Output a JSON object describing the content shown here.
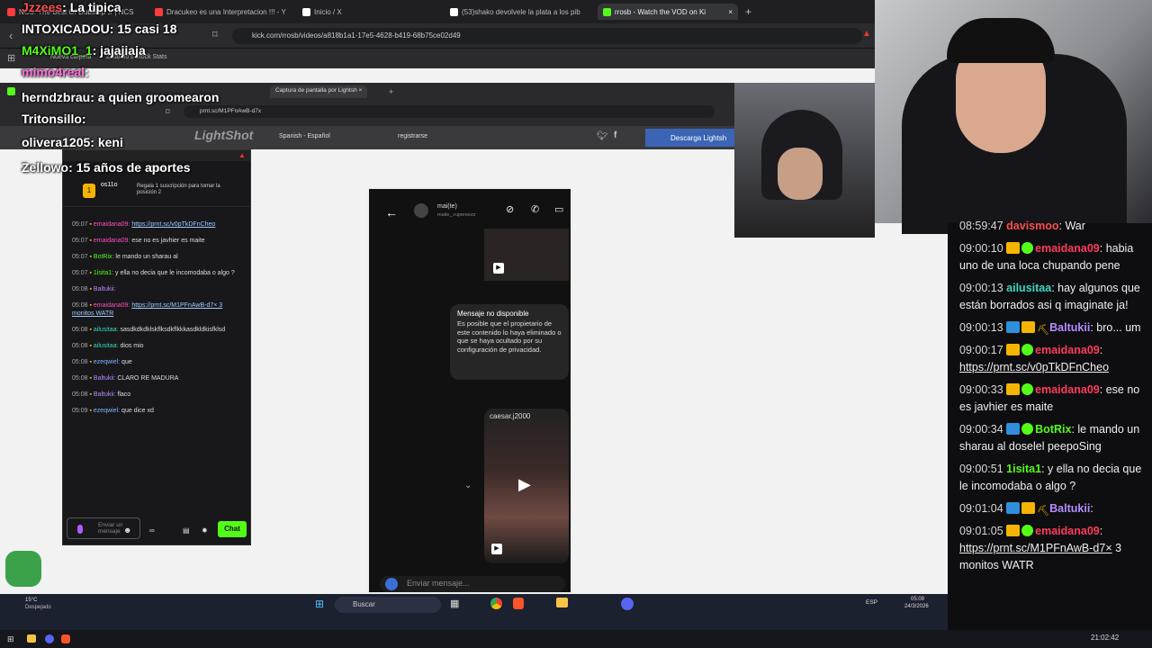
{
  "browser": {
    "tabs": [
      {
        "label": "NCS: The Best Of Dubstep ♫ | NCS",
        "color": "#ff3b3b"
      },
      {
        "label": "Dracukeo es una Interpretacion !!! - Y",
        "color": "#ff3b3b"
      },
      {
        "label": "Inicio / X",
        "color": "#ffffff"
      },
      {
        "label": "(53)shako devolvele la plata a los pib",
        "color": "#ffffff"
      },
      {
        "label": "rrosb - Watch the VOD on Ki",
        "color": "#53fc18"
      }
    ],
    "new_tab": "+",
    "url": "kick.com/rrosb/videos/a818b1a1-17e5-4628-b419-68b75ce02d49",
    "bookmarks": [
      "Nueva carpeta",
      "Zalando's Stock Stats"
    ]
  },
  "inner_browser": {
    "tabs": [
      "Captura de pantalla por Lightsh"
    ],
    "url": "prnt.sc/M1PFnAwB-d7x",
    "lang": "Spanish - Español",
    "register": "registrarse",
    "download": "Descarga Lightsh",
    "logo": "LightShot"
  },
  "kick_panel": {
    "title": "Chat",
    "sub_user": "os11o",
    "sub_note": "Regala 1 suscripción para tomar la posición 2",
    "rank": "1",
    "messages": [
      {
        "t": "05:07",
        "u": "emaidana09:",
        "c": "u-pink",
        "m": "https://prnt.sc/v0pTkDFnCheo",
        "link": true
      },
      {
        "t": "05:07",
        "u": "emaidana09:",
        "c": "u-pink",
        "m": "ese no es javhier es maite"
      },
      {
        "t": "05:07",
        "u": "BotRix:",
        "c": "u-green",
        "m": "le mando un sharau al"
      },
      {
        "t": "05:07",
        "u": "1isita1:",
        "c": "u-green",
        "m": "y ella no decia que le incomodaba o algo ?"
      },
      {
        "t": "05:08",
        "u": "Baltukii:",
        "c": "u-purple",
        "m": ""
      },
      {
        "t": "05:08",
        "u": "emaidana09:",
        "c": "u-pink",
        "m": "https://prnt.sc/M1PFnAwB-d7× 3 monitos WATR",
        "link": true
      },
      {
        "t": "05:08",
        "u": "ailusitaa:",
        "c": "u-teal",
        "m": "sasdkdkdklskflksdkflkkkasdkldkisfklsd"
      },
      {
        "t": "05:08",
        "u": "ailusitaa:",
        "c": "u-teal",
        "m": "dios mio"
      },
      {
        "t": "05:08",
        "u": "ezeqwiel:",
        "c": "u-blue",
        "m": "que"
      },
      {
        "t": "05:08",
        "u": "Baltukii:",
        "c": "u-purple",
        "m": "CLARO RE MADURA"
      },
      {
        "t": "05:08",
        "u": "Baltukii:",
        "c": "u-purple",
        "m": "flaco"
      },
      {
        "t": "05:09",
        "u": "ezeqwiel:",
        "c": "u-blue",
        "m": "que dice xd"
      }
    ],
    "input_placeholder": "Enviar un mensaje",
    "send_label": "Chat"
  },
  "phone": {
    "contact": "mai(te)",
    "contact_sub": "maite_.rupereezz",
    "unavailable_title": "Mensaje no disponible",
    "unavailable_body": "Es posible que el propietario de este contenido lo haya eliminado o que se haya ocultado por su configuración de privacidad.",
    "reel_user": "caesar.j2000",
    "input_placeholder": "Enviar mensaje..."
  },
  "overlay_chat": [
    {
      "u": "Jzzees",
      "m": "La tipica",
      "c": "#ff4f4f"
    },
    {
      "u": "INTOXICADOU",
      "m": "15 casi 18",
      "c": "#ffffff"
    },
    {
      "u": "M4XiMO1_1",
      "m": "jajajiaja",
      "c": "#53fc18"
    },
    {
      "u": "mimo4real",
      "m": "",
      "c": "#ff6fd8"
    },
    {
      "u": "herndzbrau",
      "m": "a quien groomearon",
      "c": "#ffffff"
    },
    {
      "u": "Tritonsillo",
      "m": "",
      "c": "#ffffff"
    },
    {
      "u": "olivera1205",
      "m": "keni",
      "c": "#ffffff"
    },
    {
      "u": "Zellowo",
      "m": "15 años de aportes",
      "c": "#ffffff"
    }
  ],
  "right_chat": [
    {
      "t": "08:59:47",
      "u": "davismoo",
      "c": "#ff4f4f",
      "m": "War",
      "badges": []
    },
    {
      "t": "09:00:10",
      "u": "emaidana09",
      "c": "#ff3b5c",
      "m": "habia uno de una loca chupando pene",
      "badges": [
        "crown",
        "veri"
      ]
    },
    {
      "t": "09:00:13",
      "u": "ailusitaa",
      "c": "#3dd6c0",
      "m": "hay algunos que están borrados asi q imaginate ja!",
      "badges": []
    },
    {
      "t": "09:00:13",
      "u": "Baltukii",
      "c": "#b58cff",
      "m": "bro... um",
      "badges": [
        "blue",
        "crown",
        "pick"
      ]
    },
    {
      "t": "09:00:17",
      "u": "emaidana09",
      "c": "#ff3b5c",
      "m": "https://prnt.sc/v0pTkDFnCheo",
      "link": true,
      "badges": [
        "crown",
        "veri"
      ]
    },
    {
      "t": "09:00:33",
      "u": "emaidana09",
      "c": "#ff3b5c",
      "m": "ese no es javhier es maite",
      "badges": [
        "crown",
        "veri"
      ]
    },
    {
      "t": "09:00:34",
      "u": "BotRix",
      "c": "#53fc18",
      "m": "le mando un sharau al doselel peepoSing",
      "badges": [
        "blue",
        "veri"
      ]
    },
    {
      "t": "09:00:51",
      "u": "1isita1",
      "c": "#53fc18",
      "m": "y ella no decia que le incomodaba o algo ?",
      "badges": []
    },
    {
      "t": "09:01:04",
      "u": "Baltukii",
      "c": "#b58cff",
      "m": "",
      "badges": [
        "blue",
        "crown",
        "pick"
      ]
    },
    {
      "t": "09:01:05",
      "u": "emaidana09",
      "c": "#ff3b5c",
      "m": "https://prnt.sc/M1PFnAwB-d7×",
      "link": true,
      "tail": " 3 monitos WATR",
      "badges": [
        "crown",
        "veri"
      ]
    }
  ],
  "taskbar": {
    "search": "Buscar",
    "weather_temp": "15°C",
    "weather_desc": "Despejado",
    "lang": "ESP",
    "time": "05:09",
    "date": "24/3/2026"
  },
  "host_taskbar": {
    "time": "21:02:42"
  }
}
